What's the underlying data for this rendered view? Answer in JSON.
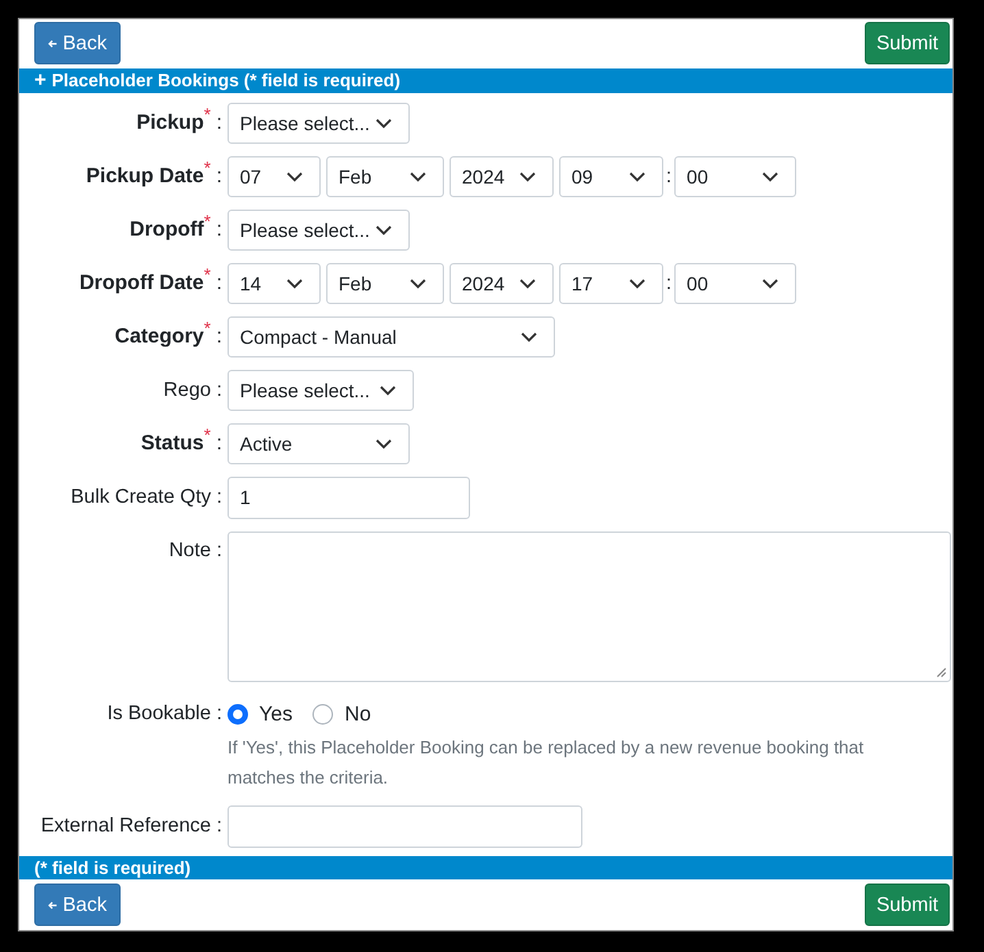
{
  "top_actions": {
    "back": "Back",
    "submit": "Submit"
  },
  "header": {
    "icon": "+",
    "title": "Placeholder Bookings (* field is required)"
  },
  "required_mark": "*",
  "separator": ":",
  "time_separator": ":",
  "fields": [
    {
      "kind": "select",
      "label": "Pickup",
      "required": true,
      "value": "Please select..."
    },
    {
      "kind": "datetime",
      "label": "Pickup Date",
      "required": true,
      "parts": [
        "07",
        "Feb",
        "2024",
        "09",
        "00"
      ]
    },
    {
      "kind": "select",
      "label": "Dropoff",
      "required": true,
      "value": "Please select..."
    },
    {
      "kind": "datetime",
      "label": "Dropoff Date",
      "required": true,
      "parts": [
        "14",
        "Feb",
        "2024",
        "17",
        "00"
      ]
    },
    {
      "kind": "select",
      "label": "Category",
      "required": true,
      "value": "Compact - Manual"
    },
    {
      "kind": "select",
      "label": "Rego",
      "required": false,
      "value": "Please select..."
    },
    {
      "kind": "select",
      "label": "Status",
      "required": true,
      "value": "Active"
    },
    {
      "kind": "input",
      "label": "Bulk Create Qty",
      "required": false,
      "value": "1"
    },
    {
      "kind": "textarea",
      "label": "Note",
      "required": false
    },
    {
      "kind": "radio",
      "label": "Is Bookable",
      "required": false,
      "options": [
        {
          "label": "Yes",
          "selected": true
        },
        {
          "label": "No",
          "selected": false
        }
      ],
      "help": "If 'Yes', this Placeholder Booking can be replaced by a new revenue booking that matches the criteria."
    },
    {
      "kind": "input",
      "label": "External Reference",
      "required": false
    }
  ],
  "footer": {
    "note": "(* field is required)"
  },
  "bottom_actions": {
    "back": "Back",
    "submit": "Submit"
  }
}
